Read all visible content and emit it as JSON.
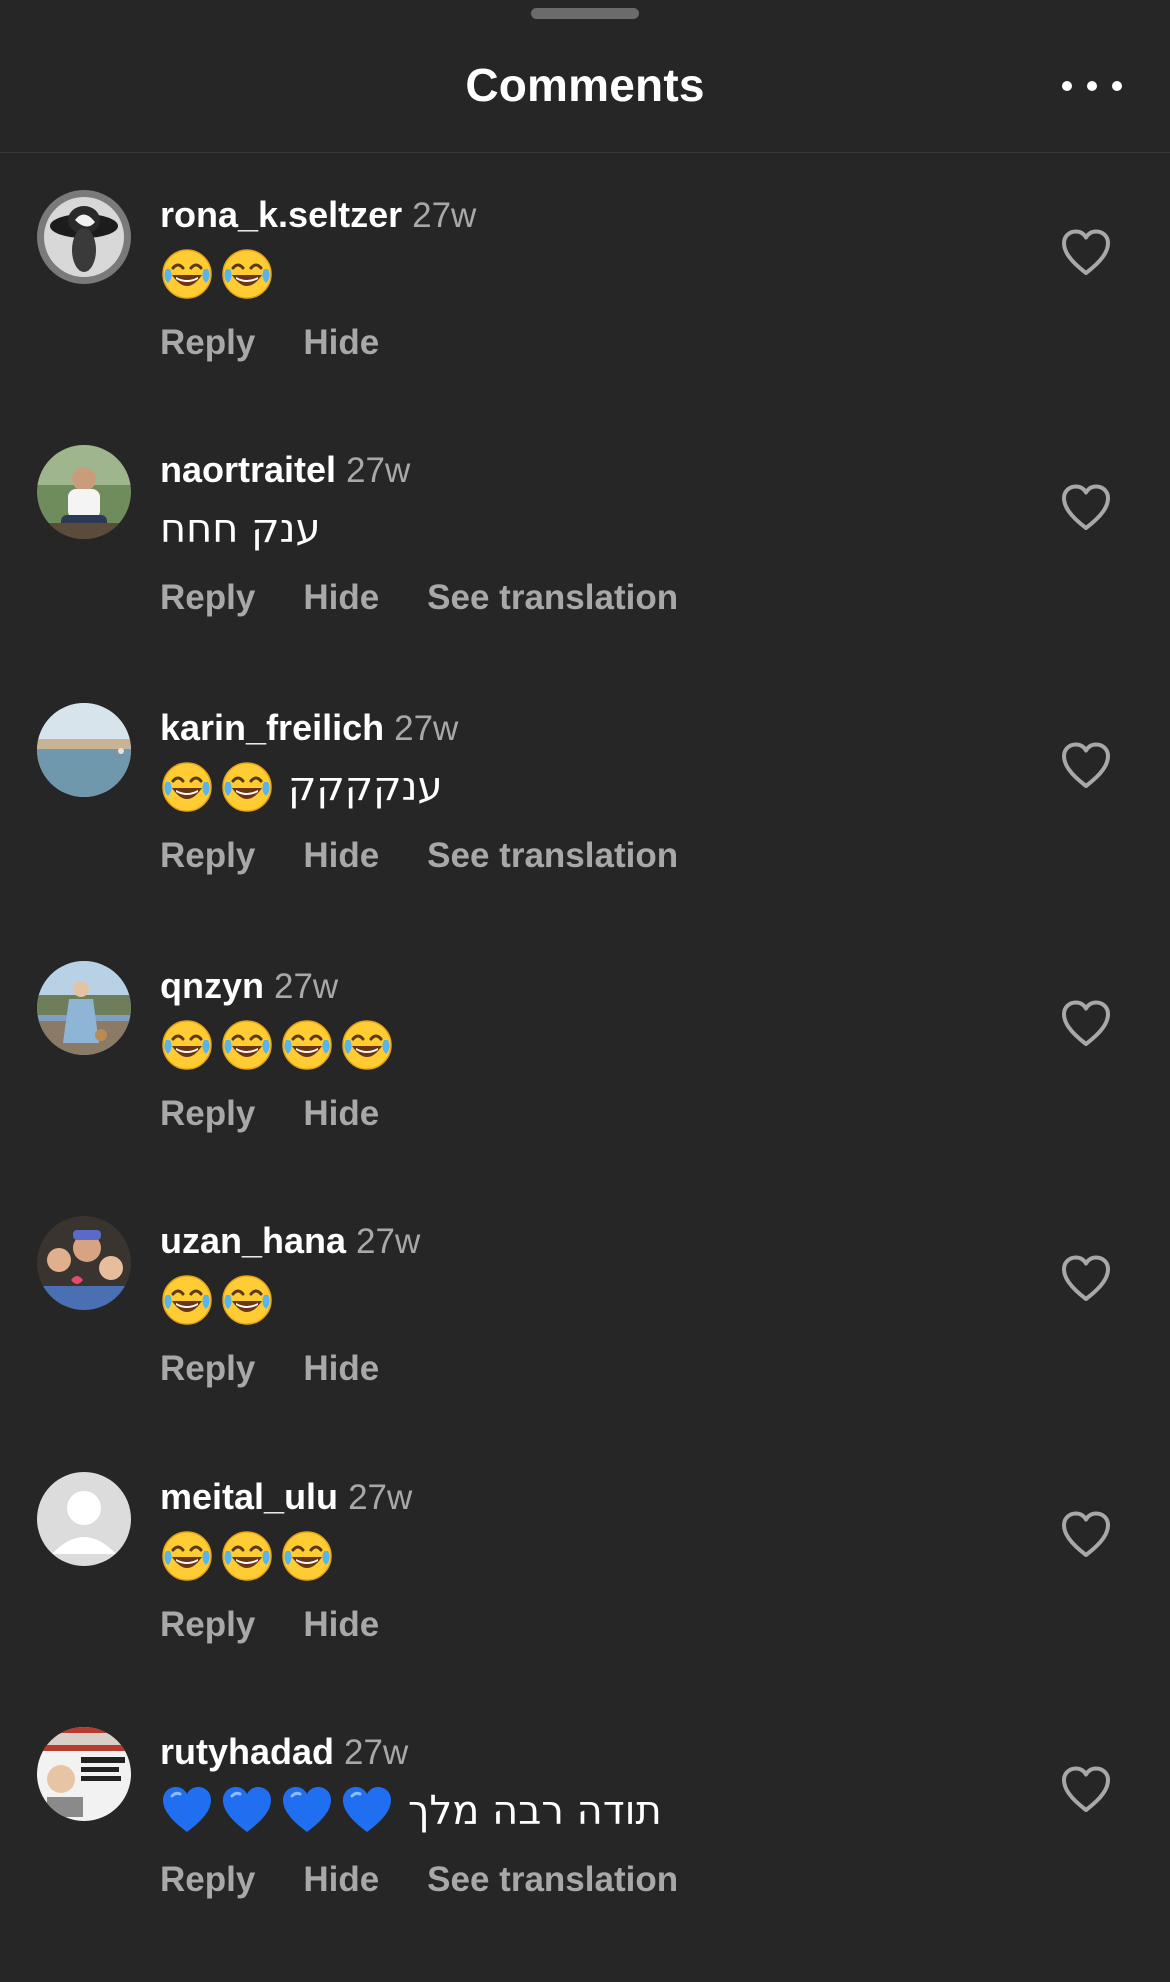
{
  "header": {
    "title": "Comments",
    "more_icon": "more-horizontal-icon"
  },
  "actions": {
    "reply_label": "Reply",
    "hide_label": "Hide",
    "translate_label": "See translation"
  },
  "colors": {
    "background": "#262626",
    "secondary_text": "#a8a8a8",
    "primary_text": "#ffffff"
  },
  "comments": [
    {
      "username": "rona_k.seltzer",
      "time": "27w",
      "emojis": [
        "joy",
        "joy"
      ],
      "text": "",
      "show_translate": false
    },
    {
      "username": "naortraitel",
      "time": "27w",
      "emojis": [],
      "text": "ענק חחח",
      "show_translate": true
    },
    {
      "username": "karin_freilich",
      "time": "27w",
      "emojis": [
        "joy",
        "joy"
      ],
      "text": "ענקקקק",
      "show_translate": true
    },
    {
      "username": "qnzyn",
      "time": "27w",
      "emojis": [
        "joy",
        "joy",
        "joy",
        "joy"
      ],
      "text": "",
      "show_translate": false
    },
    {
      "username": "uzan_hana",
      "time": "27w",
      "emojis": [
        "joy",
        "joy"
      ],
      "text": "",
      "show_translate": false
    },
    {
      "username": "meital_ulu",
      "time": "27w",
      "emojis": [
        "joy",
        "joy",
        "joy"
      ],
      "text": "",
      "show_translate": false
    },
    {
      "username": "rutyhadad",
      "time": "27w",
      "emojis": [
        "blue-heart",
        "blue-heart",
        "blue-heart",
        "blue-heart"
      ],
      "text": "תודה רבה מלך",
      "show_translate": true
    }
  ]
}
